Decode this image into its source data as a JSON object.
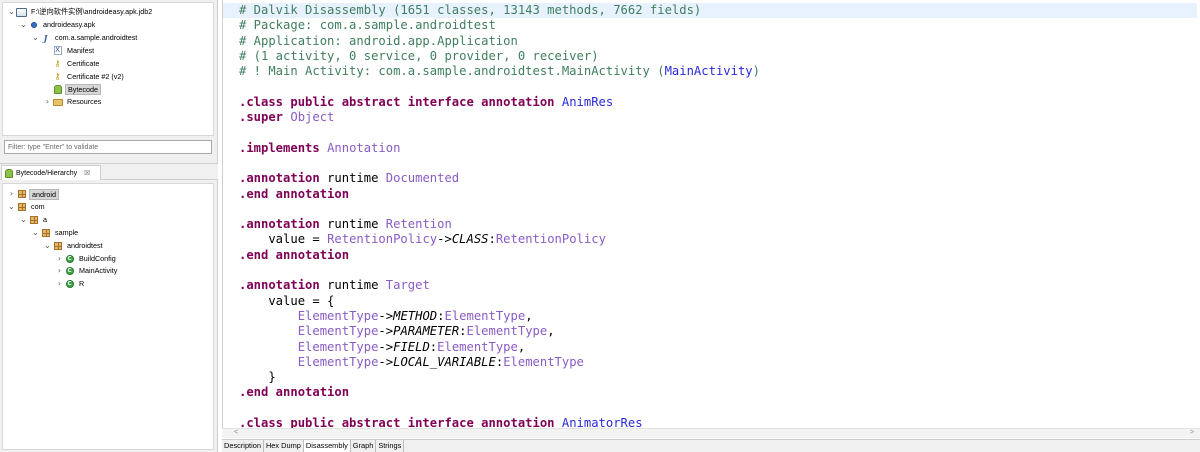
{
  "project_tree": {
    "rows": [
      {
        "label": "F:\\逆向软件实例\\androideasy.apk.jdb2",
        "icon": "database-icon",
        "twisty": "expanded",
        "depth": 0
      },
      {
        "label": "androideasy.apk",
        "icon": "apk-icon",
        "twisty": "expanded",
        "depth": 1
      },
      {
        "label": "com.a.sample.androidtest",
        "icon": "package-j-icon",
        "twisty": "expanded",
        "depth": 2
      },
      {
        "label": "Manifest",
        "icon": "xml-file-icon",
        "twisty": "none",
        "depth": 3
      },
      {
        "label": "Certificate",
        "icon": "key-icon",
        "twisty": "none",
        "depth": 3
      },
      {
        "label": "Certificate #2 (v2)",
        "icon": "key-icon",
        "twisty": "none",
        "depth": 3
      },
      {
        "label": "Bytecode",
        "icon": "android-icon",
        "twisty": "none",
        "depth": 3,
        "selected": true
      },
      {
        "label": "Resources",
        "icon": "folder-icon",
        "twisty": "collapsed",
        "depth": 3
      }
    ]
  },
  "filter": {
    "placeholder": "Filter: type \"Enter\" to validate"
  },
  "hierarchy_tab": {
    "label": "Bytecode/Hierarchy",
    "close": "☒"
  },
  "hierarchy_tree": {
    "rows": [
      {
        "label": "android",
        "icon": "package-icon",
        "twisty": "collapsed",
        "depth": 0,
        "selected": true
      },
      {
        "label": "com",
        "icon": "package-icon",
        "twisty": "expanded",
        "depth": 0
      },
      {
        "label": "a",
        "icon": "package-icon",
        "twisty": "expanded",
        "depth": 1
      },
      {
        "label": "sample",
        "icon": "package-icon",
        "twisty": "expanded",
        "depth": 2
      },
      {
        "label": "androidtest",
        "icon": "package-icon",
        "twisty": "expanded",
        "depth": 3
      },
      {
        "label": "BuildConfig",
        "icon": "class-icon",
        "twisty": "collapsed",
        "depth": 4
      },
      {
        "label": "MainActivity",
        "icon": "class-icon",
        "twisty": "collapsed",
        "depth": 4
      },
      {
        "label": "R",
        "icon": "class-icon",
        "twisty": "collapsed",
        "depth": 4
      }
    ]
  },
  "code_lines": [
    {
      "hl": true,
      "parts": [
        [
          "cm",
          "# Dalvik Disassembly (1651 classes, 13143 methods, 7662 fields)"
        ]
      ]
    },
    {
      "parts": [
        [
          "cm",
          "# Package: com.a.sample.androidtest"
        ]
      ]
    },
    {
      "parts": [
        [
          "cm",
          "# Application: android.app.Application"
        ]
      ]
    },
    {
      "parts": [
        [
          "cm",
          "# (1 activity, 0 service, 0 provider, 0 receiver)"
        ]
      ]
    },
    {
      "parts": [
        [
          "cm",
          "# ! Main Activity: com.a.sample.androidtest.MainActivity ("
        ],
        [
          "tyb",
          "MainActivity"
        ],
        [
          "cm",
          ")"
        ]
      ]
    },
    {
      "parts": []
    },
    {
      "parts": [
        [
          "kw",
          ".class public abstract interface annotation "
        ],
        [
          "tyb",
          "AnimRes"
        ]
      ]
    },
    {
      "parts": [
        [
          "kw",
          ".super "
        ],
        [
          "ty",
          "Object"
        ]
      ]
    },
    {
      "parts": []
    },
    {
      "parts": [
        [
          "kw",
          ".implements "
        ],
        [
          "ty",
          "Annotation"
        ]
      ]
    },
    {
      "parts": []
    },
    {
      "parts": [
        [
          "kw",
          ".annotation "
        ],
        [
          "op",
          "runtime "
        ],
        [
          "ty",
          "Documented"
        ]
      ]
    },
    {
      "parts": [
        [
          "kw",
          ".end annotation"
        ]
      ]
    },
    {
      "parts": []
    },
    {
      "parts": [
        [
          "kw",
          ".annotation "
        ],
        [
          "op",
          "runtime "
        ],
        [
          "ty",
          "Retention"
        ]
      ]
    },
    {
      "parts": [
        [
          "op",
          "    value = "
        ],
        [
          "ty",
          "RetentionPolicy"
        ],
        [
          "op",
          "->"
        ],
        [
          "it",
          "CLASS"
        ],
        [
          "op",
          ":"
        ],
        [
          "ty",
          "RetentionPolicy"
        ]
      ]
    },
    {
      "parts": [
        [
          "kw",
          ".end annotation"
        ]
      ]
    },
    {
      "parts": []
    },
    {
      "parts": [
        [
          "kw",
          ".annotation "
        ],
        [
          "op",
          "runtime "
        ],
        [
          "ty",
          "Target"
        ]
      ]
    },
    {
      "parts": [
        [
          "op",
          "    value = {"
        ]
      ]
    },
    {
      "parts": [
        [
          "op",
          "        "
        ],
        [
          "ty",
          "ElementType"
        ],
        [
          "op",
          "->"
        ],
        [
          "it",
          "METHOD"
        ],
        [
          "op",
          ":"
        ],
        [
          "ty",
          "ElementType"
        ],
        [
          "op",
          ","
        ]
      ]
    },
    {
      "parts": [
        [
          "op",
          "        "
        ],
        [
          "ty",
          "ElementType"
        ],
        [
          "op",
          "->"
        ],
        [
          "it",
          "PARAMETER"
        ],
        [
          "op",
          ":"
        ],
        [
          "ty",
          "ElementType"
        ],
        [
          "op",
          ","
        ]
      ]
    },
    {
      "parts": [
        [
          "op",
          "        "
        ],
        [
          "ty",
          "ElementType"
        ],
        [
          "op",
          "->"
        ],
        [
          "it",
          "FIELD"
        ],
        [
          "op",
          ":"
        ],
        [
          "ty",
          "ElementType"
        ],
        [
          "op",
          ","
        ]
      ]
    },
    {
      "parts": [
        [
          "op",
          "        "
        ],
        [
          "ty",
          "ElementType"
        ],
        [
          "op",
          "->"
        ],
        [
          "it",
          "LOCAL_VARIABLE"
        ],
        [
          "op",
          ":"
        ],
        [
          "ty",
          "ElementType"
        ]
      ]
    },
    {
      "parts": [
        [
          "op",
          "    }"
        ]
      ]
    },
    {
      "parts": [
        [
          "kw",
          ".end annotation"
        ]
      ]
    },
    {
      "parts": []
    },
    {
      "parts": [
        [
          "kw",
          ".class public abstract interface annotation "
        ],
        [
          "tyb",
          "AnimatorRes"
        ]
      ]
    }
  ],
  "scrollbar": {
    "left": "<",
    "right": ">"
  },
  "bottom_tabs": [
    {
      "label": "Description"
    },
    {
      "label": "Hex Dump"
    },
    {
      "label": "Disassembly",
      "active": true
    },
    {
      "label": "Graph"
    },
    {
      "label": "Strings"
    }
  ]
}
